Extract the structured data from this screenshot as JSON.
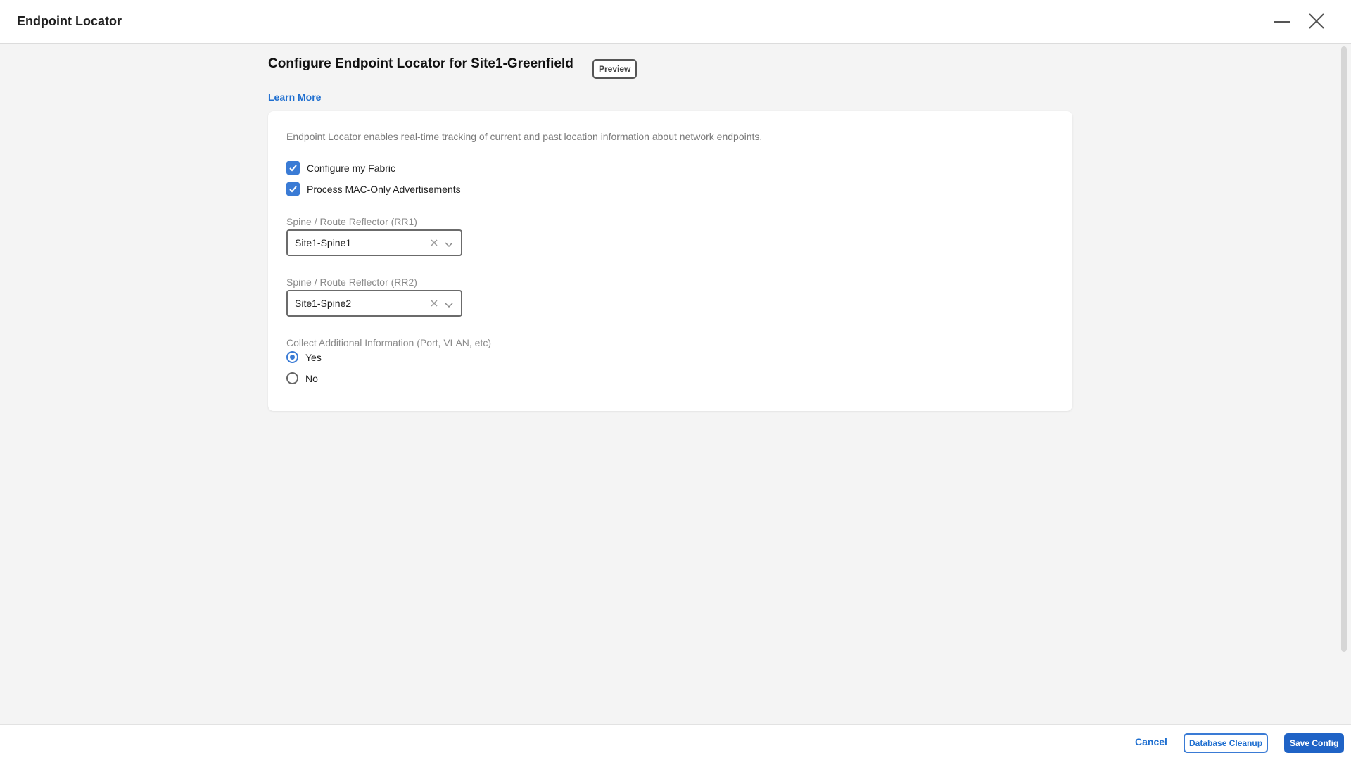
{
  "window": {
    "title": "Endpoint Locator",
    "minimize_icon": "minimize-icon",
    "close_icon": "close-icon"
  },
  "header": {
    "title": "Configure Endpoint Locator for Site1-Greenfield",
    "badge": "Preview",
    "learn_more": "Learn More"
  },
  "form": {
    "description": "Endpoint Locator enables real-time tracking of current and past location information about network endpoints.",
    "checkboxes": [
      {
        "label": "Configure my Fabric",
        "checked": true
      },
      {
        "label": "Process MAC-Only Advertisements",
        "checked": true
      }
    ],
    "rr1": {
      "label": "Spine / Route Reflector (RR1)",
      "value": "Site1-Spine1"
    },
    "rr2": {
      "label": "Spine / Route Reflector (RR2)",
      "value": "Site1-Spine2"
    },
    "collect": {
      "label": "Collect Additional Information (Port, VLAN, etc)",
      "options": [
        {
          "label": "Yes",
          "selected": true
        },
        {
          "label": "No",
          "selected": false
        }
      ]
    }
  },
  "footer": {
    "cancel": "Cancel",
    "database_cleanup": "Database Cleanup",
    "save_config": "Save Config"
  },
  "colors": {
    "accent": "#1f6fd0",
    "primary_button": "#1f63c6",
    "checkbox": "#3a7bd5"
  }
}
